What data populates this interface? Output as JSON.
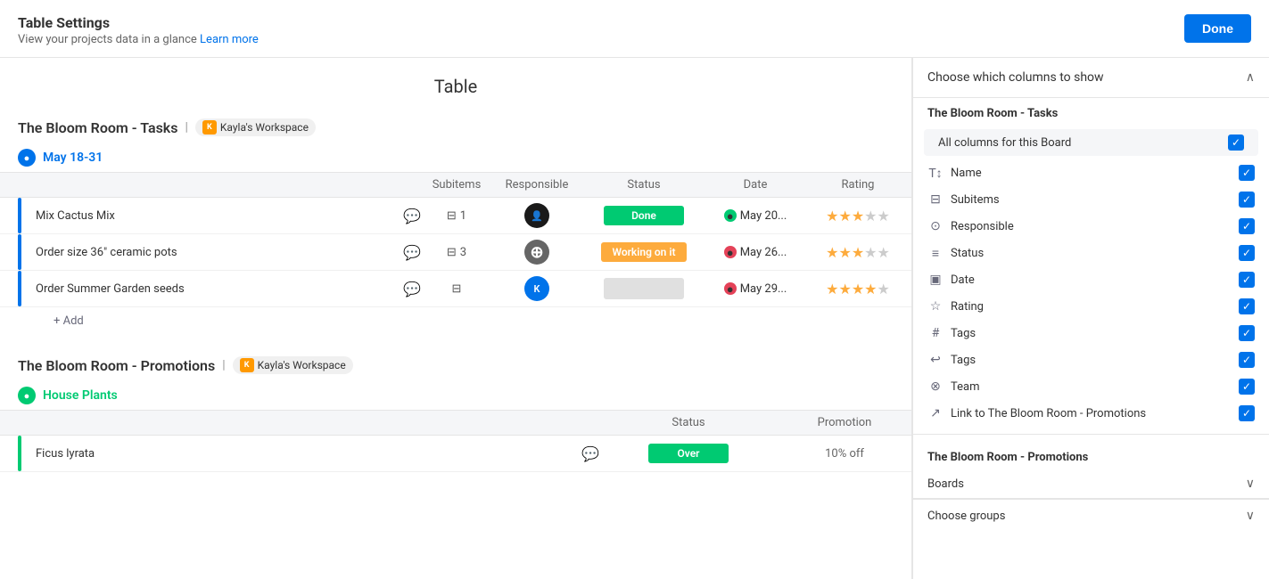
{
  "header": {
    "title": "Table Settings",
    "subtitle": "View your projects data in a glance",
    "learn_more": "Learn more",
    "done_label": "Done"
  },
  "main": {
    "panel_title": "Table",
    "board1": {
      "title": "The Bloom Room - Tasks",
      "separator": "|",
      "workspace": "Kayla's Workspace",
      "workspace_color": "#ff9900",
      "workspace_initial": "K",
      "group": {
        "label": "May 18-31",
        "icon_color": "blue"
      },
      "columns": {
        "subitems": "Subitems",
        "responsible": "Responsible",
        "status": "Status",
        "date": "Date",
        "rating": "Rating"
      },
      "rows": [
        {
          "name": "Mix Cactus Mix",
          "subitems": "1",
          "status": "Done",
          "status_type": "done",
          "date": "May 20...",
          "date_dot": "green",
          "rating": 3,
          "avatar": "dark"
        },
        {
          "name": "Order size 36\" ceramic pots",
          "subitems": "3",
          "status": "Working on it",
          "status_type": "wip",
          "date": "May 26...",
          "date_dot": "red",
          "rating": 3,
          "avatar": "multi"
        },
        {
          "name": "Order Summer Garden seeds",
          "subitems": "",
          "status": "",
          "status_type": "empty",
          "date": "May 29...",
          "date_dot": "red",
          "rating": 4,
          "avatar": "blue"
        }
      ],
      "add_label": "+ Add"
    },
    "board2": {
      "title": "The Bloom Room - Promotions",
      "separator": "|",
      "workspace": "Kayla's Workspace",
      "workspace_color": "#ff9900",
      "workspace_initial": "K",
      "group": {
        "label": "House Plants",
        "icon_color": "green"
      },
      "columns": {
        "status": "Status",
        "promotion": "Promotion"
      },
      "rows": [
        {
          "name": "Ficus lyrata",
          "status": "Over",
          "status_type": "over",
          "promotion": "10% off"
        }
      ]
    }
  },
  "right_panel": {
    "columns_section": {
      "title": "Choose which columns to show"
    },
    "board1_label": "The Bloom Room - Tasks",
    "all_columns_label": "All columns for this Board",
    "columns": [
      {
        "icon": "T↕",
        "label": "Name"
      },
      {
        "icon": "⊟",
        "label": "Subitems"
      },
      {
        "icon": "⊙",
        "label": "Responsible"
      },
      {
        "icon": "≡",
        "label": "Status"
      },
      {
        "icon": "▣",
        "label": "Date"
      },
      {
        "icon": "☆",
        "label": "Rating"
      },
      {
        "icon": "#",
        "label": "Tags"
      },
      {
        "icon": "↩",
        "label": "Tags"
      },
      {
        "icon": "⊗",
        "label": "Team"
      },
      {
        "icon": "↗",
        "label": "Link to The Bloom Room - Promotions"
      }
    ],
    "board2_label": "The Bloom Room - Promotions",
    "boards_dropdown": "Boards",
    "choose_groups": "Choose groups"
  }
}
